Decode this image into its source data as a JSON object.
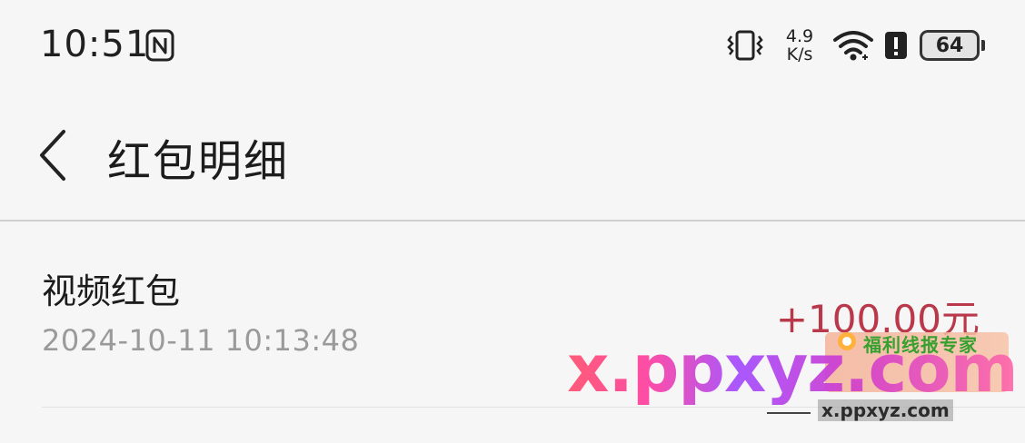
{
  "status_bar": {
    "time": "10:51",
    "net_speed_value": "4.9",
    "net_speed_unit": "K/s",
    "battery_level": "64",
    "icons": [
      "nfc-icon",
      "vibrate-icon",
      "wifi-icon",
      "alert-icon",
      "battery-icon"
    ]
  },
  "header": {
    "title": "红包明细",
    "back_icon": "chevron-left-icon"
  },
  "records": [
    {
      "title": "视频红包",
      "time": "2024-10-11 10:13:48",
      "amount": "+100.00元"
    }
  ],
  "watermark": {
    "main_text": "x.ppxyz.com",
    "badge_text": "福利线报专家",
    "url_text": "x.ppxyz.com"
  },
  "colors": {
    "background": "#f6f6f6",
    "amount": "#b9384a",
    "secondary_text": "#9a9a9a",
    "divider": "#cfcfcf"
  }
}
